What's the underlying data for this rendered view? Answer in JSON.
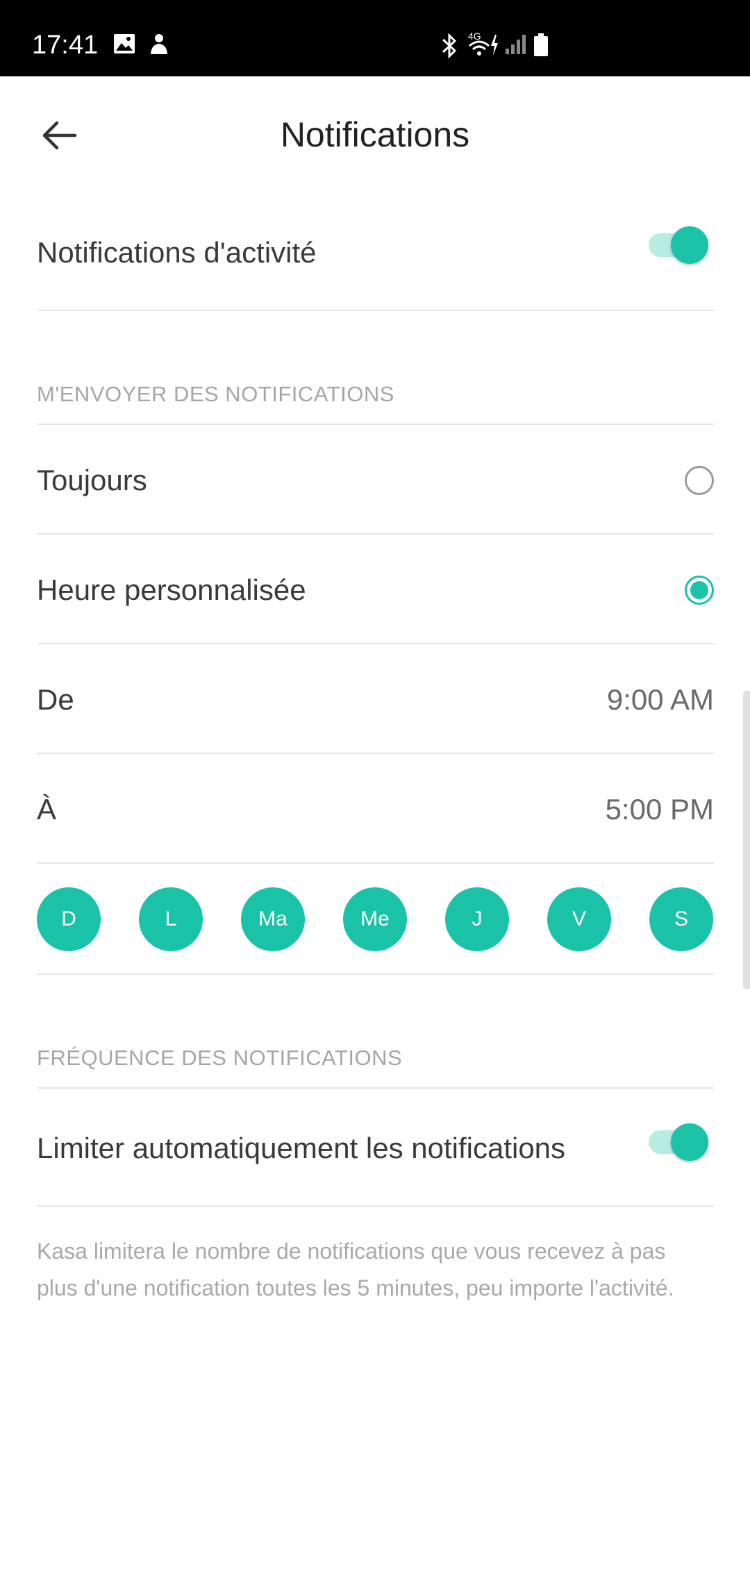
{
  "status_bar": {
    "time": "17:41",
    "network": "4G"
  },
  "header": {
    "title": "Notifications"
  },
  "activity": {
    "label": "Notifications d'activité",
    "enabled": true
  },
  "send_section": {
    "heading": "M'ENVOYER DES NOTIFICATIONS",
    "options": [
      {
        "label": "Toujours",
        "selected": false
      },
      {
        "label": "Heure personnalisée",
        "selected": true
      }
    ],
    "from": {
      "label": "De",
      "value": "9:00 AM"
    },
    "to": {
      "label": "À",
      "value": "5:00 PM"
    },
    "days": [
      "D",
      "L",
      "Ma",
      "Me",
      "J",
      "V",
      "S"
    ]
  },
  "frequency_section": {
    "heading": "FRÉQUENCE DES NOTIFICATIONS",
    "limit_label": "Limiter automatiquement les notifications",
    "limit_enabled": true,
    "note": "Kasa limitera le nombre de notifications que vous recevez à pas plus d'une notification toutes les 5 minutes, peu importe l'activité."
  },
  "colors": {
    "accent": "#1ac3a8",
    "track": "#b7ece3"
  }
}
